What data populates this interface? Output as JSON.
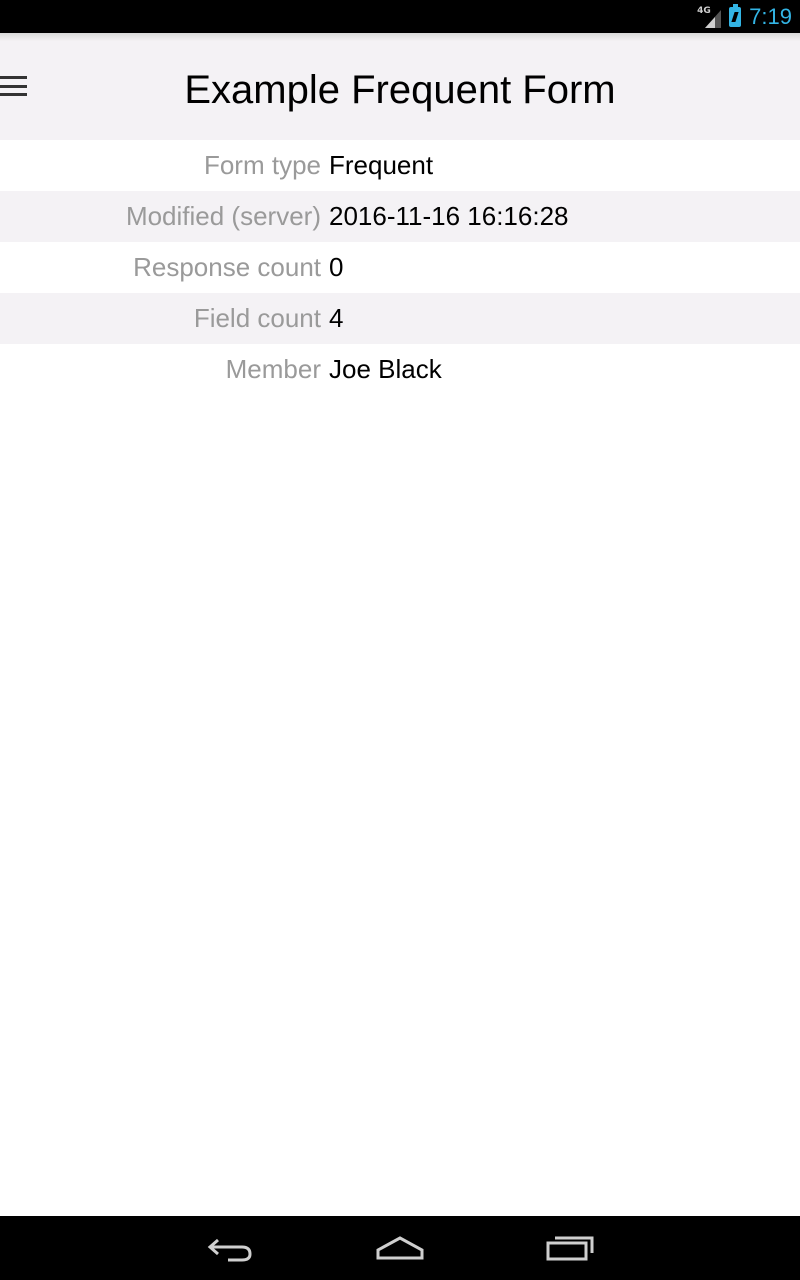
{
  "status_bar": {
    "network": "4G",
    "time": "7:19"
  },
  "app_bar": {
    "title": "Example Frequent Form",
    "menu_icon": "hamburger-menu-icon"
  },
  "details": [
    {
      "label": "Form type",
      "value": "Frequent"
    },
    {
      "label": "Modified (server)",
      "value": "2016-11-16 16:16:28"
    },
    {
      "label": "Response count",
      "value": "0"
    },
    {
      "label": "Field count",
      "value": "4"
    },
    {
      "label": "Member",
      "value": "Joe Black"
    }
  ],
  "nav_bar": {
    "back_icon": "back-icon",
    "home_icon": "home-icon",
    "recents_icon": "recent-apps-icon"
  },
  "colors": {
    "accent": "#33b5e5",
    "header_bg": "#f4f2f5",
    "label": "#9a9a9a"
  }
}
